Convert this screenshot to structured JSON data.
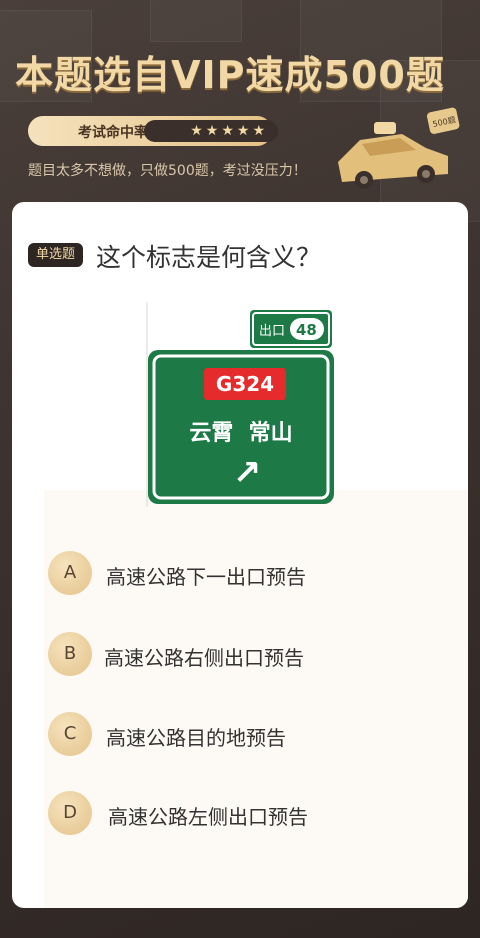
{
  "header": {
    "title": "本题选自VIP速成500题",
    "rate_label": "考试命中率",
    "rate_stars": "★★★★★",
    "subtitle": "题目太多不想做，只做500题，考过没压力！",
    "car_badge": "500题"
  },
  "question": {
    "type_badge": "单选题",
    "text": "这个标志是何含义？"
  },
  "sign": {
    "exit_label": "出口",
    "exit_number": "48",
    "route": "G324",
    "destinations": "云霄  常山",
    "arrow": "↗",
    "colors": {
      "green": "#1d7a46",
      "red": "#e52b2b",
      "white": "#ffffff"
    }
  },
  "options": [
    {
      "letter": "A",
      "text": "高速公路下一出口预告"
    },
    {
      "letter": "B",
      "text": "高速公路右侧出口预告"
    },
    {
      "letter": "C",
      "text": "高速公路目的地预告"
    },
    {
      "letter": "D",
      "text": "高速公路左侧出口预告"
    }
  ]
}
